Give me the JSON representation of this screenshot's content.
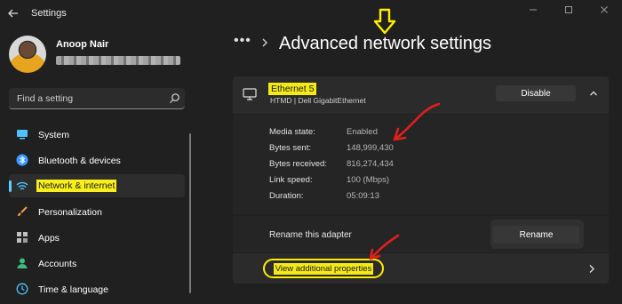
{
  "window": {
    "title": "Settings",
    "controls": [
      "minimize",
      "maximize",
      "close"
    ]
  },
  "user": {
    "name": "Anoop Nair"
  },
  "search": {
    "placeholder": "Find a setting"
  },
  "sidebar": {
    "items": [
      {
        "label": "System",
        "icon": "system-icon",
        "color": "#4cc2ff"
      },
      {
        "label": "Bluetooth & devices",
        "icon": "bluetooth-icon",
        "color": "#3b9cff"
      },
      {
        "label": "Network & internet",
        "icon": "wifi-icon",
        "color": "#4cc2ff",
        "active": true
      },
      {
        "label": "Personalization",
        "icon": "brush-icon",
        "color": "#f0a04b"
      },
      {
        "label": "Apps",
        "icon": "apps-icon",
        "color": "#c0c0c0"
      },
      {
        "label": "Accounts",
        "icon": "person-icon",
        "color": "#3dbd7d"
      },
      {
        "label": "Time & language",
        "icon": "globe-clock-icon",
        "color": "#4cc2ff"
      }
    ]
  },
  "header": {
    "more": "•••",
    "title": "Advanced network settings"
  },
  "adapter": {
    "name": "Ethernet 5",
    "description": "HTMD | Dell GigabitEthernet",
    "disable_label": "Disable",
    "properties": [
      {
        "label": "Media state:",
        "value": "Enabled"
      },
      {
        "label": "Bytes sent:",
        "value": "148,999,430"
      },
      {
        "label": "Bytes received:",
        "value": "816,274,434"
      },
      {
        "label": "Link speed:",
        "value": "100 (Mbps)"
      },
      {
        "label": "Duration:",
        "value": "05:09:13"
      }
    ],
    "rename_label": "Rename this adapter",
    "rename_button": "Rename",
    "view_properties": "View additional properties"
  },
  "colors": {
    "accent": "#60cdff",
    "highlight": "#f4ea18",
    "annotation_red": "#e0201c",
    "annotation_yellow": "#ffee00"
  }
}
